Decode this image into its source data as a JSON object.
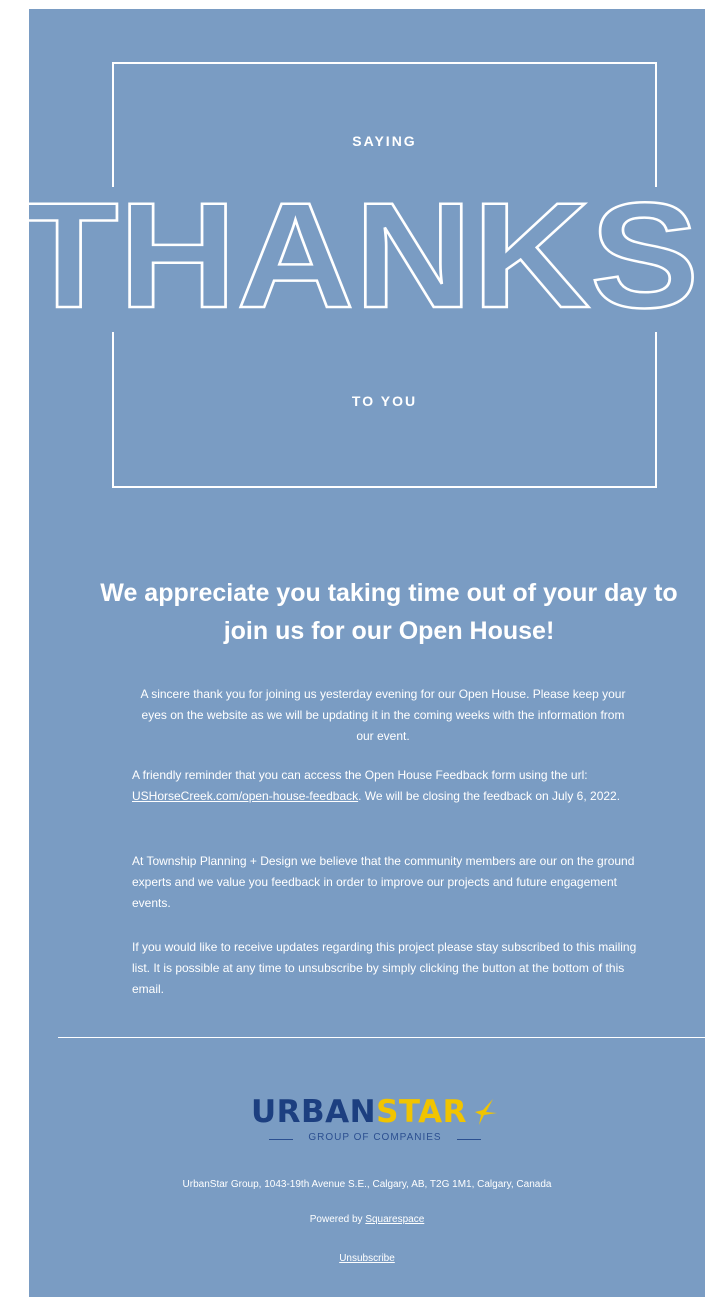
{
  "hero": {
    "top_text": "SAYING",
    "big_word": "THANKS",
    "bottom_text": "TO YOU"
  },
  "headline": {
    "line1": "We appreciate you taking time out of your day to",
    "line2": "join us for our Open House!"
  },
  "body": {
    "intro": "A sincere thank you for joining us yesterday evening for our Open House. Please keep your eyes on the website as we will be updating it in the coming weeks with the information from our event.",
    "reminder_before": "A friendly reminder that you can access the Open House Feedback form using the url: ",
    "feedback_link": "USHorseCreek.com/open-house-feedback",
    "reminder_after": ". We will be closing the feedback on July 6, 2022.",
    "community": "At Township Planning + Design we believe that the community members are our on the ground experts and we value you feedback in order to improve our projects and future engagement events.",
    "updates": "If you would like to receive updates regarding this project please stay subscribed to this mailing list. It is possible at any time to unsubscribe by simply clicking the button at the bottom of this email."
  },
  "logo": {
    "part1": "URBAN",
    "part2": "STAR",
    "subtitle": "GROUP OF COMPANIES",
    "icon": "star-icon"
  },
  "footer": {
    "address": "UrbanStar Group, 1043-19th Avenue S.E., Calgary, AB, T2G 1M1, Calgary, Canada",
    "powered_prefix": "Powered by ",
    "powered_link": "Squarespace",
    "unsubscribe": "Unsubscribe"
  },
  "colors": {
    "background": "#7a9cc3",
    "logo_navy": "#1c3f80",
    "logo_yellow": "#f1c400"
  }
}
